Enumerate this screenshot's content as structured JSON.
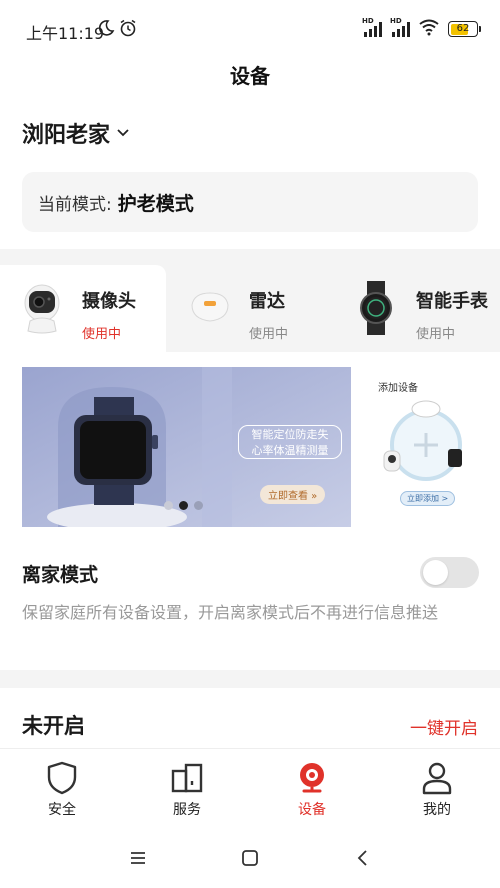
{
  "status_bar": {
    "time": "上午11:19",
    "battery": "62",
    "network_labels": [
      "HD",
      "HD"
    ]
  },
  "page": {
    "title": "设备"
  },
  "location": {
    "name": "浏阳老家"
  },
  "mode": {
    "prefix": "当前模式:",
    "value": "护老模式"
  },
  "devices": [
    {
      "name": "摄像头",
      "status": "使用中",
      "icon": "camera-icon",
      "active": true
    },
    {
      "name": "雷达",
      "status": "使用中",
      "icon": "radar-icon",
      "active": false
    },
    {
      "name": "智能手表",
      "status": "使用中",
      "icon": "watch-icon",
      "active": false
    }
  ],
  "banner": {
    "line1": "智能定位防走失",
    "line2": "心率体温精测量",
    "button": "立即查看",
    "page_count": 3,
    "current_page": 2
  },
  "add_device": {
    "title": "添加设备",
    "button": "立即添加"
  },
  "away_mode": {
    "title": "离家模式",
    "description": "保留家庭所有设备设置，开启离家模式后不再进行信息推送",
    "enabled": false
  },
  "schedule": {
    "status": "未开启",
    "action": "一键开启"
  },
  "nav": [
    {
      "label": "安全",
      "icon": "shield-icon"
    },
    {
      "label": "服务",
      "icon": "service-icon"
    },
    {
      "label": "设备",
      "icon": "device-icon",
      "active": true
    },
    {
      "label": "我的",
      "icon": "user-icon"
    }
  ],
  "colors": {
    "accent": "#e0322a",
    "card_bg": "#f5f5f5",
    "toggle_off": "#e4e4e4"
  }
}
